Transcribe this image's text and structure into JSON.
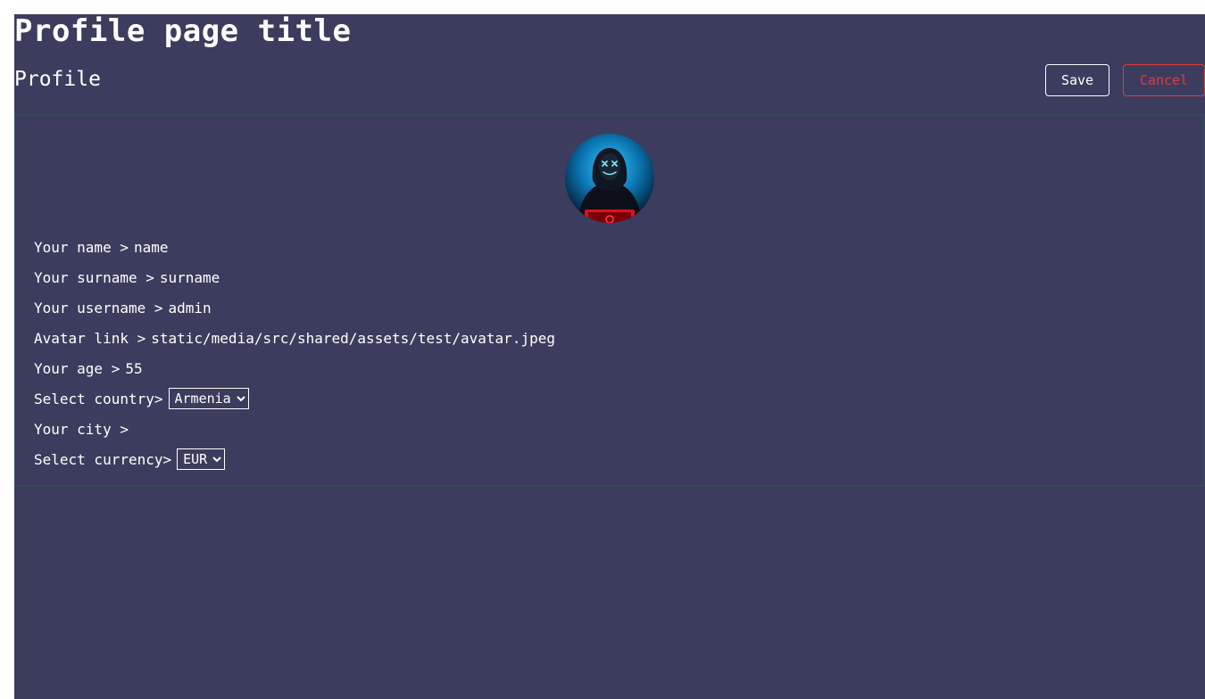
{
  "page": {
    "title": "Profile page title"
  },
  "header": {
    "section_title": "Profile",
    "save_label": "Save",
    "cancel_label": "Cancel"
  },
  "avatar": {
    "icon": "hooded-hacker-avatar"
  },
  "fields": {
    "name": {
      "label": "Your name >",
      "value": "name"
    },
    "surname": {
      "label": "Your surname >",
      "value": "surname"
    },
    "username": {
      "label": "Your username >",
      "value": "admin"
    },
    "avatar_link": {
      "label": "Avatar link >",
      "value": "static/media/src/shared/assets/test/avatar.jpeg"
    },
    "age": {
      "label": "Your age >",
      "value": "55"
    },
    "country": {
      "label": "Select country>",
      "selected": "Armenia"
    },
    "city": {
      "label": "Your city >",
      "value": ""
    },
    "currency": {
      "label": "Select currency>",
      "selected": "EUR"
    }
  },
  "colors": {
    "background": "#3c3c5e",
    "text": "#ffffff",
    "cancel": "#e23b3b",
    "card_border": "#344a55"
  }
}
